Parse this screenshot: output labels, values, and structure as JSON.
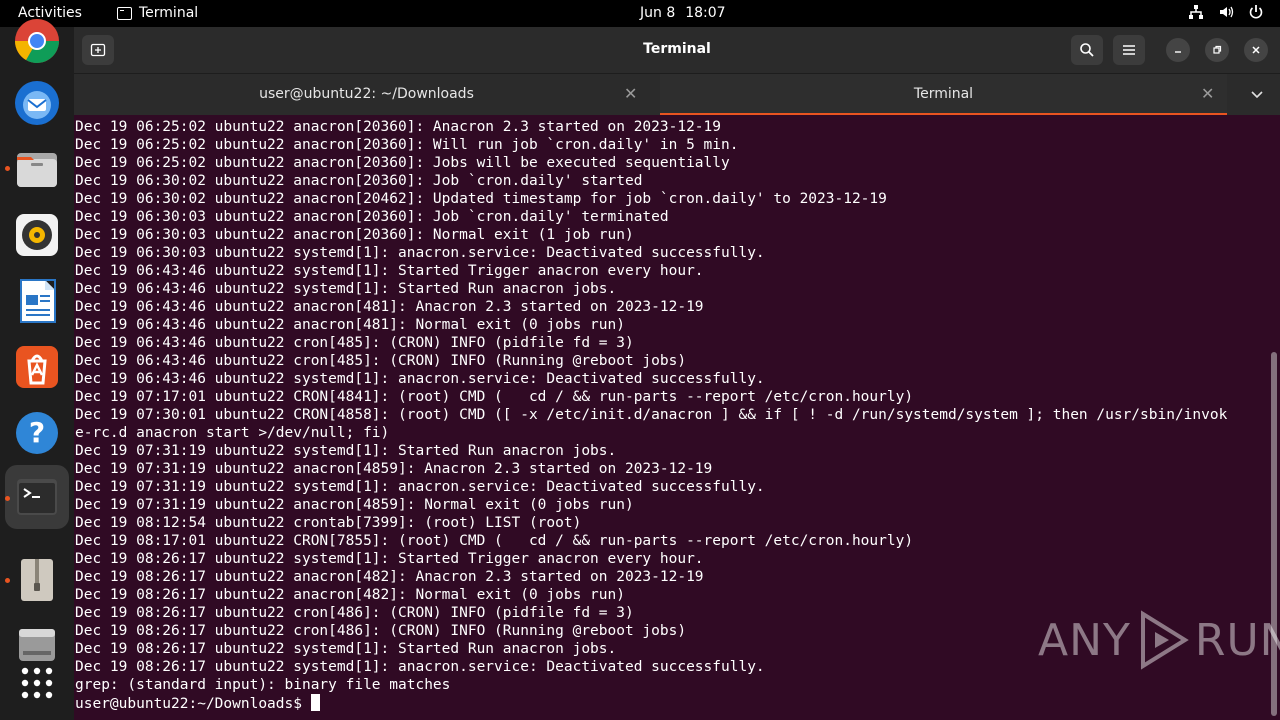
{
  "topbar": {
    "activities": "Activities",
    "app_name": "Terminal",
    "date": "Jun 8",
    "time": "18:07"
  },
  "window": {
    "title": "Terminal",
    "tabs": [
      {
        "label": "user@ubuntu22: ~/Downloads",
        "active": false
      },
      {
        "label": "Terminal",
        "active": true
      }
    ]
  },
  "dock": {
    "items": [
      "chrome-icon",
      "thunderbird-icon",
      "files-icon",
      "rhythmbox-icon",
      "writer-icon",
      "app-center-icon",
      "help-icon",
      "terminal-icon",
      "archive-icon",
      "drive-icon",
      "show-apps-icon"
    ]
  },
  "terminal": {
    "lines": [
      "Dec 19 06:25:02 ubuntu22 anacron[20360]: Anacron 2.3 started on 2023-12-19",
      "Dec 19 06:25:02 ubuntu22 anacron[20360]: Will run job `cron.daily' in 5 min.",
      "Dec 19 06:25:02 ubuntu22 anacron[20360]: Jobs will be executed sequentially",
      "Dec 19 06:30:02 ubuntu22 anacron[20360]: Job `cron.daily' started",
      "Dec 19 06:30:02 ubuntu22 anacron[20462]: Updated timestamp for job `cron.daily' to 2023-12-19",
      "Dec 19 06:30:03 ubuntu22 anacron[20360]: Job `cron.daily' terminated",
      "Dec 19 06:30:03 ubuntu22 anacron[20360]: Normal exit (1 job run)",
      "Dec 19 06:30:03 ubuntu22 systemd[1]: anacron.service: Deactivated successfully.",
      "Dec 19 06:43:46 ubuntu22 systemd[1]: Started Trigger anacron every hour.",
      "Dec 19 06:43:46 ubuntu22 systemd[1]: Started Run anacron jobs.",
      "Dec 19 06:43:46 ubuntu22 anacron[481]: Anacron 2.3 started on 2023-12-19",
      "Dec 19 06:43:46 ubuntu22 anacron[481]: Normal exit (0 jobs run)",
      "Dec 19 06:43:46 ubuntu22 cron[485]: (CRON) INFO (pidfile fd = 3)",
      "Dec 19 06:43:46 ubuntu22 cron[485]: (CRON) INFO (Running @reboot jobs)",
      "Dec 19 06:43:46 ubuntu22 systemd[1]: anacron.service: Deactivated successfully.",
      "Dec 19 07:17:01 ubuntu22 CRON[4841]: (root) CMD (   cd / && run-parts --report /etc/cron.hourly)",
      "Dec 19 07:30:01 ubuntu22 CRON[4858]: (root) CMD ([ -x /etc/init.d/anacron ] && if [ ! -d /run/systemd/system ]; then /usr/sbin/invok",
      "e-rc.d anacron start >/dev/null; fi)",
      "Dec 19 07:31:19 ubuntu22 systemd[1]: Started Run anacron jobs.",
      "Dec 19 07:31:19 ubuntu22 anacron[4859]: Anacron 2.3 started on 2023-12-19",
      "Dec 19 07:31:19 ubuntu22 systemd[1]: anacron.service: Deactivated successfully.",
      "Dec 19 07:31:19 ubuntu22 anacron[4859]: Normal exit (0 jobs run)",
      "Dec 19 08:12:54 ubuntu22 crontab[7399]: (root) LIST (root)",
      "Dec 19 08:17:01 ubuntu22 CRON[7855]: (root) CMD (   cd / && run-parts --report /etc/cron.hourly)",
      "Dec 19 08:26:17 ubuntu22 systemd[1]: Started Trigger anacron every hour.",
      "Dec 19 08:26:17 ubuntu22 anacron[482]: Anacron 2.3 started on 2023-12-19",
      "Dec 19 08:26:17 ubuntu22 anacron[482]: Normal exit (0 jobs run)",
      "Dec 19 08:26:17 ubuntu22 cron[486]: (CRON) INFO (pidfile fd = 3)",
      "Dec 19 08:26:17 ubuntu22 cron[486]: (CRON) INFO (Running @reboot jobs)",
      "Dec 19 08:26:17 ubuntu22 systemd[1]: Started Run anacron jobs.",
      "Dec 19 08:26:17 ubuntu22 systemd[1]: anacron.service: Deactivated successfully.",
      "grep: (standard input): binary file matches"
    ],
    "prompt": "user@ubuntu22:~/Downloads$ "
  },
  "watermark": {
    "text_left": "ANY",
    "text_right": "RUN"
  },
  "colors": {
    "accent": "#e95420",
    "terminal_bg": "#300a24",
    "headerbar": "#2b2b2b"
  }
}
